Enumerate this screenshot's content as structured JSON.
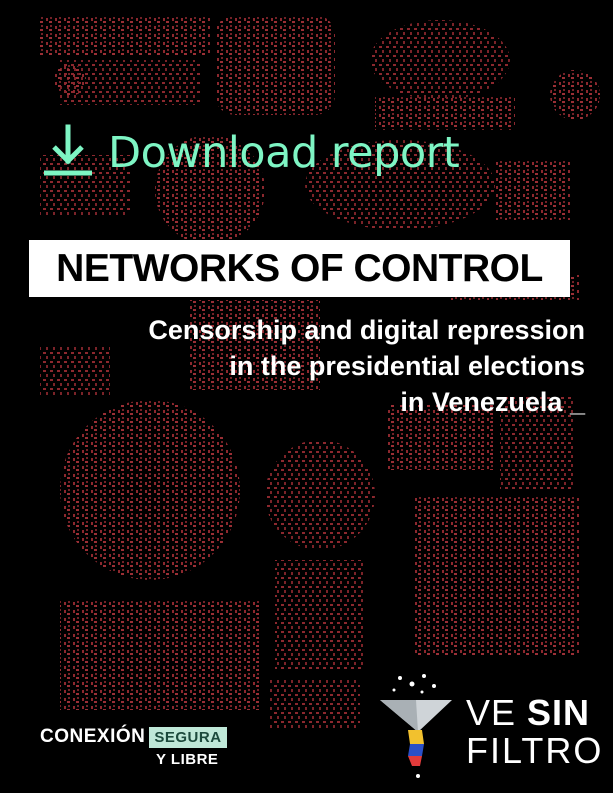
{
  "download": {
    "label": "Download report",
    "icon": "download-arrow-icon",
    "color": "#7ef5c4"
  },
  "report": {
    "title": "NETWORKS OF CONTROL",
    "subtitle_line1": "Censorship and digital repression",
    "subtitle_line2": "in the presidential elections",
    "subtitle_line3": "in Venezuela",
    "cursor": "_"
  },
  "brand_left": {
    "word1": "CONEXIÓN",
    "word2": "SEGURA",
    "word3": "Y LIBRE",
    "accent": "#bfe8d8"
  },
  "brand_right": {
    "ve": "VE",
    "sin": "SIN",
    "filtro": "FILTRO",
    "icon": "funnel-logo-icon"
  },
  "colors": {
    "background": "#000000",
    "ascii_art": "#b0323a",
    "title_box": "#ffffff"
  }
}
